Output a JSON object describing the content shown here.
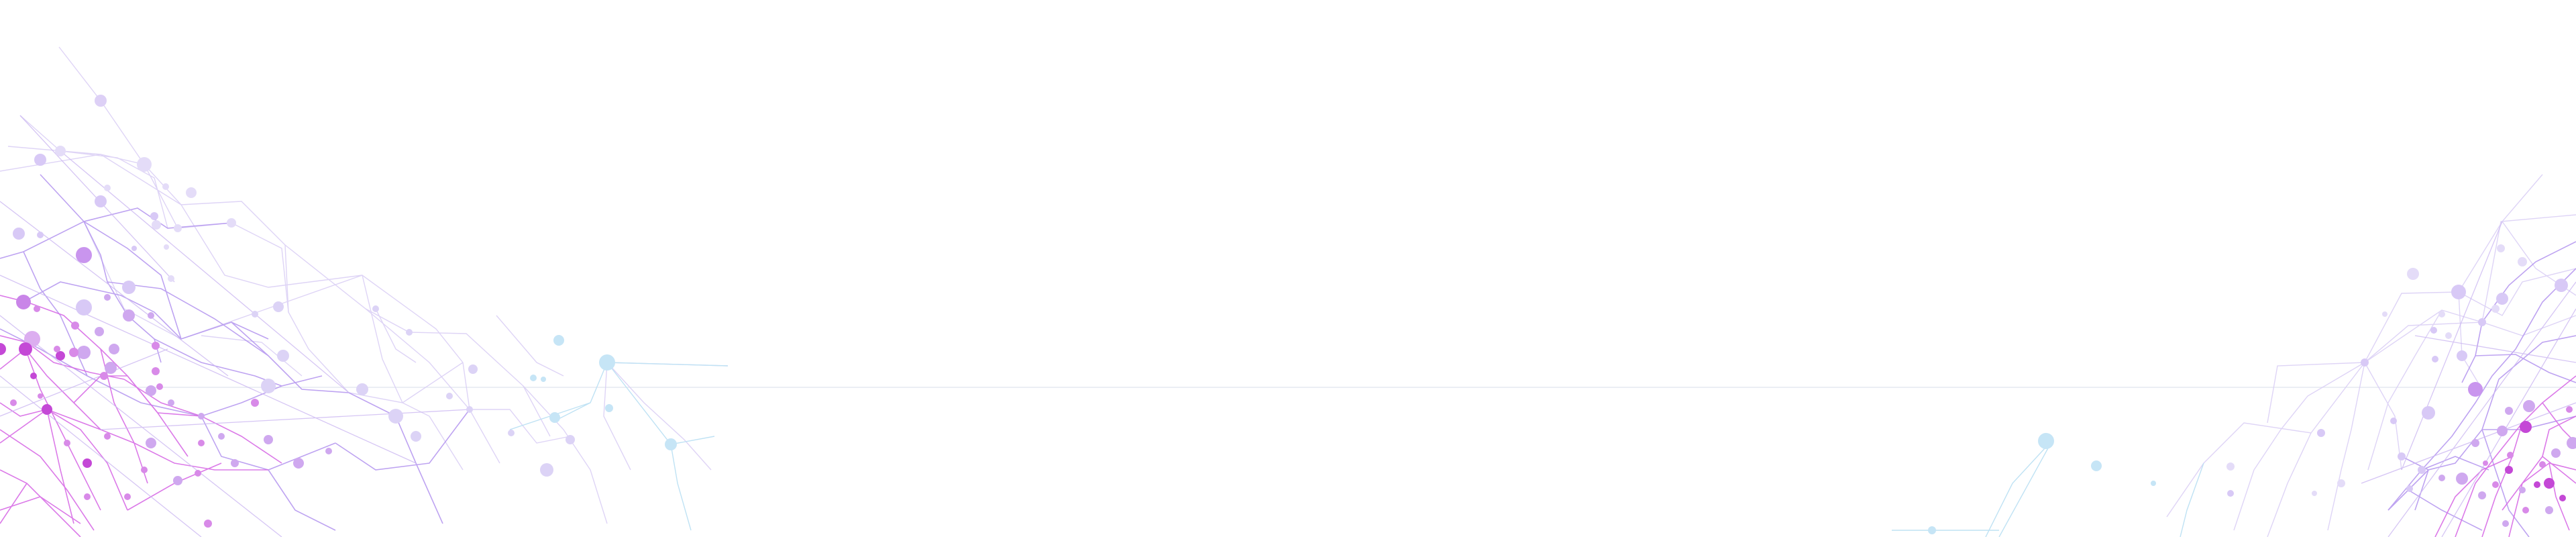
{
  "background": {
    "color": "#ffffff",
    "theme": "abstract network / plexus of connected nodes",
    "palette": {
      "magenta": "#c23ad6",
      "violet": "#a66cf0",
      "lavender": "#c9b4f3",
      "sky": "#a9d8f2",
      "divider": "#dfe3ee"
    }
  }
}
